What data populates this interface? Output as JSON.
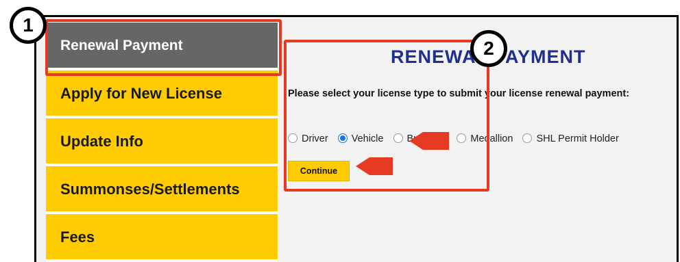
{
  "sidebar": {
    "items": [
      {
        "label": "Renewal Payment"
      },
      {
        "label": "Apply for New License"
      },
      {
        "label": "Update Info"
      },
      {
        "label": "Summonses/Settlements"
      },
      {
        "label": "Fees"
      }
    ],
    "active_index": 0
  },
  "main": {
    "title": "RENEWAL PAYMENT",
    "instruction": "Please select your license type to submit your license renewal payment:",
    "license_types": [
      {
        "label": "Driver",
        "checked": false
      },
      {
        "label": "Vehicle",
        "checked": true
      },
      {
        "label": "Business",
        "checked": false
      },
      {
        "label": "Medallion",
        "checked": false
      },
      {
        "label": "SHL Permit Holder",
        "checked": false
      }
    ],
    "continue_label": "Continue"
  },
  "annotations": {
    "badge_1": "1",
    "badge_2": "2"
  },
  "colors": {
    "sidebar_yellow": "#fecc00",
    "active_gray": "#666666",
    "title_blue": "#1f2f8e",
    "highlight_red": "#e63a22",
    "radio_blue": "#1a73e8"
  }
}
